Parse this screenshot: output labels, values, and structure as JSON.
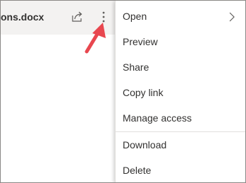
{
  "file": {
    "name": "ons.docx"
  },
  "icons": {
    "share": "share-icon",
    "more": "more-vertical-icon",
    "submenu": "chevron-right-icon",
    "annotation": "red-arrow-icon"
  },
  "menu": {
    "items": [
      {
        "label": "Open",
        "has_submenu": true
      },
      {
        "label": "Preview"
      },
      {
        "label": "Share"
      },
      {
        "label": "Copy link"
      },
      {
        "label": "Manage access"
      },
      {
        "label": "Download"
      },
      {
        "label": "Delete"
      }
    ]
  },
  "colors": {
    "row_background": "#f3f2f1",
    "annotation_arrow": "#e8474f",
    "text": "#323130"
  }
}
